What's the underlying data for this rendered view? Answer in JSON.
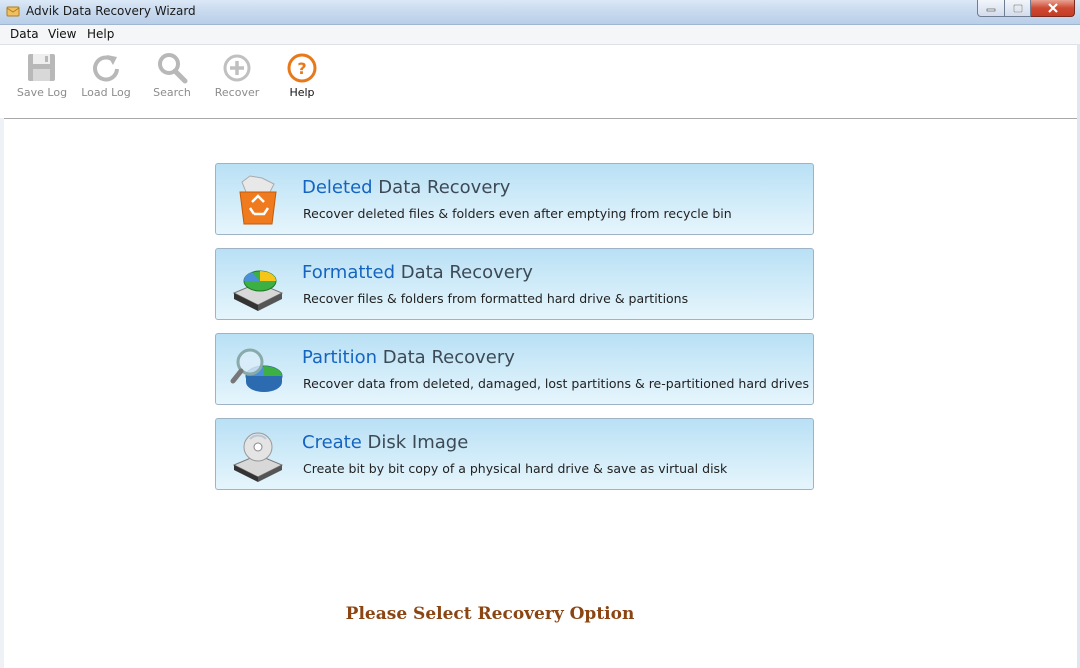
{
  "window": {
    "title": "Advik Data Recovery Wizard",
    "controls": [
      "minimize-icon",
      "maximize-icon",
      "close-icon"
    ]
  },
  "menu": {
    "items": [
      {
        "label": "Data"
      },
      {
        "label": "View"
      },
      {
        "label": "Help"
      }
    ]
  },
  "toolbar": {
    "items": [
      {
        "label": "Save Log",
        "icon": "floppy-disk-icon",
        "enabled": false
      },
      {
        "label": "Load Log",
        "icon": "refresh-icon",
        "enabled": false
      },
      {
        "label": "Search",
        "icon": "search-icon",
        "enabled": false
      },
      {
        "label": "Recover",
        "icon": "plus-circle-icon",
        "enabled": false
      },
      {
        "label": "Help",
        "icon": "help-icon",
        "enabled": true
      }
    ]
  },
  "options": [
    {
      "key": "Deleted",
      "rest": " Data Recovery",
      "desc": "Recover deleted files & folders even after emptying from recycle bin",
      "icon": "recycle-bin-icon"
    },
    {
      "key": "Formatted",
      "rest": " Data Recovery",
      "desc": "Recover files & folders from formatted hard drive & partitions",
      "icon": "formatted-drive-icon"
    },
    {
      "key": "Partition",
      "rest": " Data Recovery",
      "desc": "Recover data from deleted, damaged, lost partitions  & re-partitioned hard drives",
      "icon": "partition-magnifier-icon"
    },
    {
      "key": "Create",
      "rest": " Disk Image",
      "desc": "Create bit by bit copy of a physical hard drive & save as virtual disk",
      "icon": "disk-image-icon"
    }
  ],
  "footer": {
    "message": "Please Select Recovery Option"
  },
  "colors": {
    "accent_blue": "#1565c0",
    "footer_brown": "#8b4513",
    "help_orange": "#e8791a"
  }
}
